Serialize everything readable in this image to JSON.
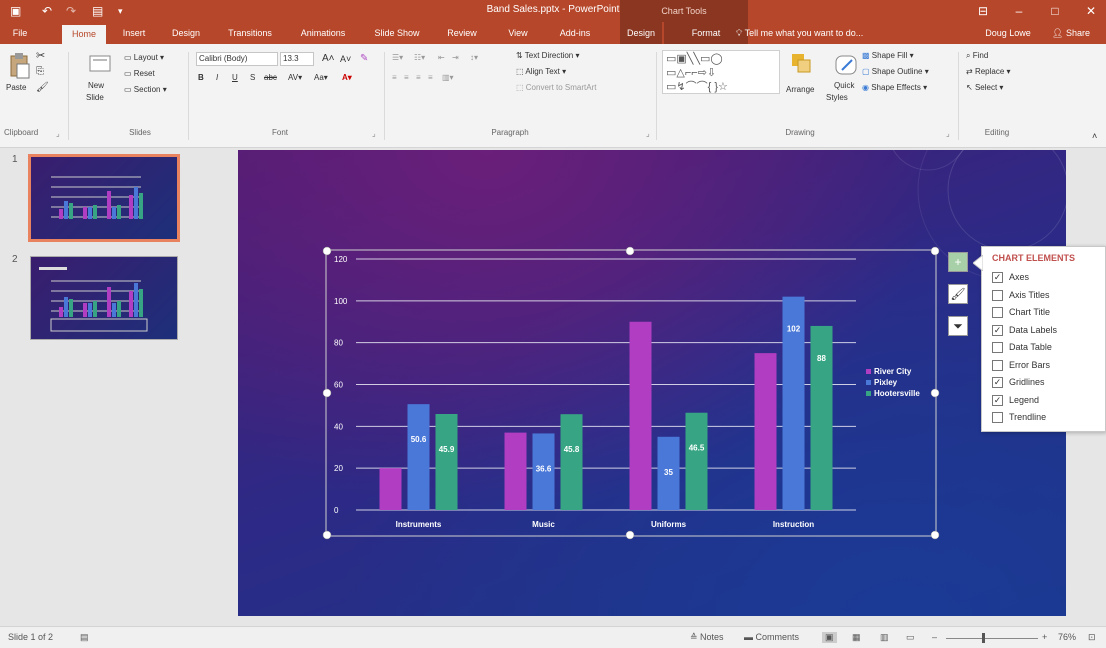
{
  "window": {
    "title": "Band Sales.pptx - PowerPoint",
    "context_tools": "Chart Tools",
    "user": "Doug Lowe",
    "share": "Share",
    "tell_me": "Tell me what you want to do..."
  },
  "tabs": [
    "File",
    "Home",
    "Insert",
    "Design",
    "Transitions",
    "Animations",
    "Slide Show",
    "Review",
    "View",
    "Add-ins",
    "Design",
    "Format"
  ],
  "ribbon": {
    "clipboard": {
      "paste": "Paste",
      "label": "Clipboard"
    },
    "slides": {
      "new_slide": "New",
      "new_slide2": "Slide",
      "layout": "Layout",
      "reset": "Reset",
      "section": "Section",
      "label": "Slides"
    },
    "font": {
      "family": "Calibri (Body)",
      "size": "13.3",
      "label": "Font"
    },
    "paragraph": {
      "text_direction": "Text Direction",
      "align_text": "Align Text",
      "convert": "Convert to SmartArt",
      "label": "Paragraph"
    },
    "drawing": {
      "arrange": "Arrange",
      "quick": "Quick",
      "quick2": "Styles",
      "shape_fill": "Shape Fill",
      "shape_outline": "Shape Outline",
      "shape_effects": "Shape Effects",
      "label": "Drawing"
    },
    "editing": {
      "find": "Find",
      "replace": "Replace",
      "select": "Select",
      "label": "Editing"
    }
  },
  "thumbnails": [
    {
      "num": "1"
    },
    {
      "num": "2"
    }
  ],
  "chart_data": {
    "type": "bar",
    "categories": [
      "Instruments",
      "Music",
      "Uniforms",
      "Instruction"
    ],
    "series": [
      {
        "name": "River City",
        "color": "#b03dc2",
        "values": [
          20,
          37,
          90,
          75
        ]
      },
      {
        "name": "Pixley",
        "color": "#4a78d8",
        "values": [
          50.6,
          36.6,
          35,
          102
        ]
      },
      {
        "name": "Hootersville",
        "color": "#37a583",
        "values": [
          45.9,
          45.8,
          46.5,
          88
        ]
      }
    ],
    "data_labels": [
      [
        "",
        "50.6",
        "45.9"
      ],
      [
        "",
        "36.6",
        "45.8"
      ],
      [
        "",
        "35",
        "46.5"
      ],
      [
        "",
        "102",
        "88"
      ]
    ],
    "yticks": [
      "0",
      "20",
      "40",
      "60",
      "80",
      "100",
      "120"
    ],
    "ylim": [
      0,
      120
    ],
    "gridlines": true,
    "legend": "right"
  },
  "chart_elements": {
    "title": "CHART ELEMENTS",
    "items": [
      {
        "label": "Axes",
        "checked": true
      },
      {
        "label": "Axis Titles",
        "checked": false
      },
      {
        "label": "Chart Title",
        "checked": false
      },
      {
        "label": "Data Labels",
        "checked": true
      },
      {
        "label": "Data Table",
        "checked": false
      },
      {
        "label": "Error Bars",
        "checked": false
      },
      {
        "label": "Gridlines",
        "checked": true
      },
      {
        "label": "Legend",
        "checked": true
      },
      {
        "label": "Trendline",
        "checked": false
      }
    ]
  },
  "status": {
    "slide": "Slide 1 of 2",
    "notes": "Notes",
    "comments": "Comments",
    "zoom": "76%"
  }
}
